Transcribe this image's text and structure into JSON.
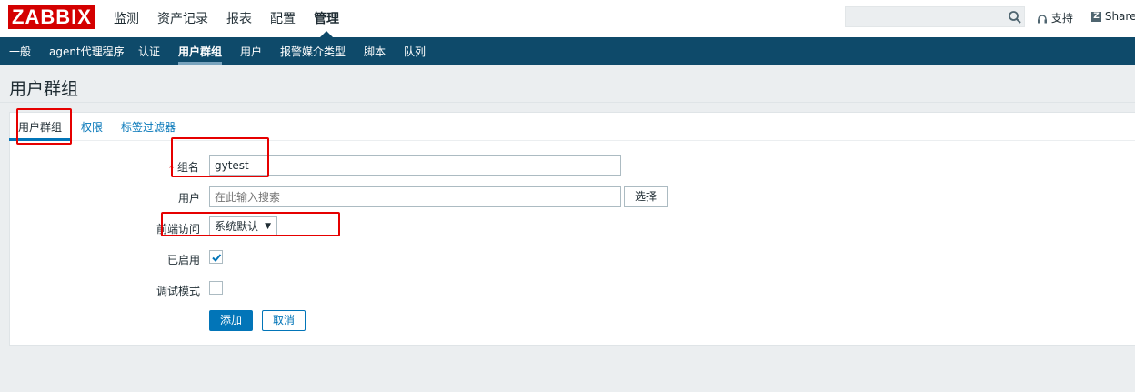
{
  "logo": "ZABBIX",
  "top_nav": [
    "监测",
    "资产记录",
    "报表",
    "配置",
    "管理"
  ],
  "top_nav_selected": "管理",
  "search": {
    "value": ""
  },
  "support_label": "支持",
  "share_label": "Share",
  "sub_nav": [
    "一般",
    "agent代理程序",
    "认证",
    "用户群组",
    "用户",
    "报警媒介类型",
    "脚本",
    "队列"
  ],
  "sub_nav_selected": "用户群组",
  "page_title": "用户群组",
  "tabs": [
    "用户群组",
    "权限",
    "标签过滤器"
  ],
  "active_tab": "用户群组",
  "form": {
    "group_name_label": "组名",
    "group_name_value": "gytest",
    "required_mark": "*",
    "users_label": "用户",
    "users_placeholder": "在此输入搜索",
    "select_button": "选择",
    "frontend_access_label": "前端访问",
    "frontend_access_value": "系统默认",
    "enabled_label": "已启用",
    "enabled_checked": true,
    "debug_label": "调试模式",
    "debug_checked": false,
    "add_button": "添加",
    "cancel_button": "取消"
  },
  "colors": {
    "brand_red": "#d40000",
    "nav_bg": "#0e4a6a",
    "link_blue": "#0275b8",
    "annotation_red": "#e60000"
  }
}
